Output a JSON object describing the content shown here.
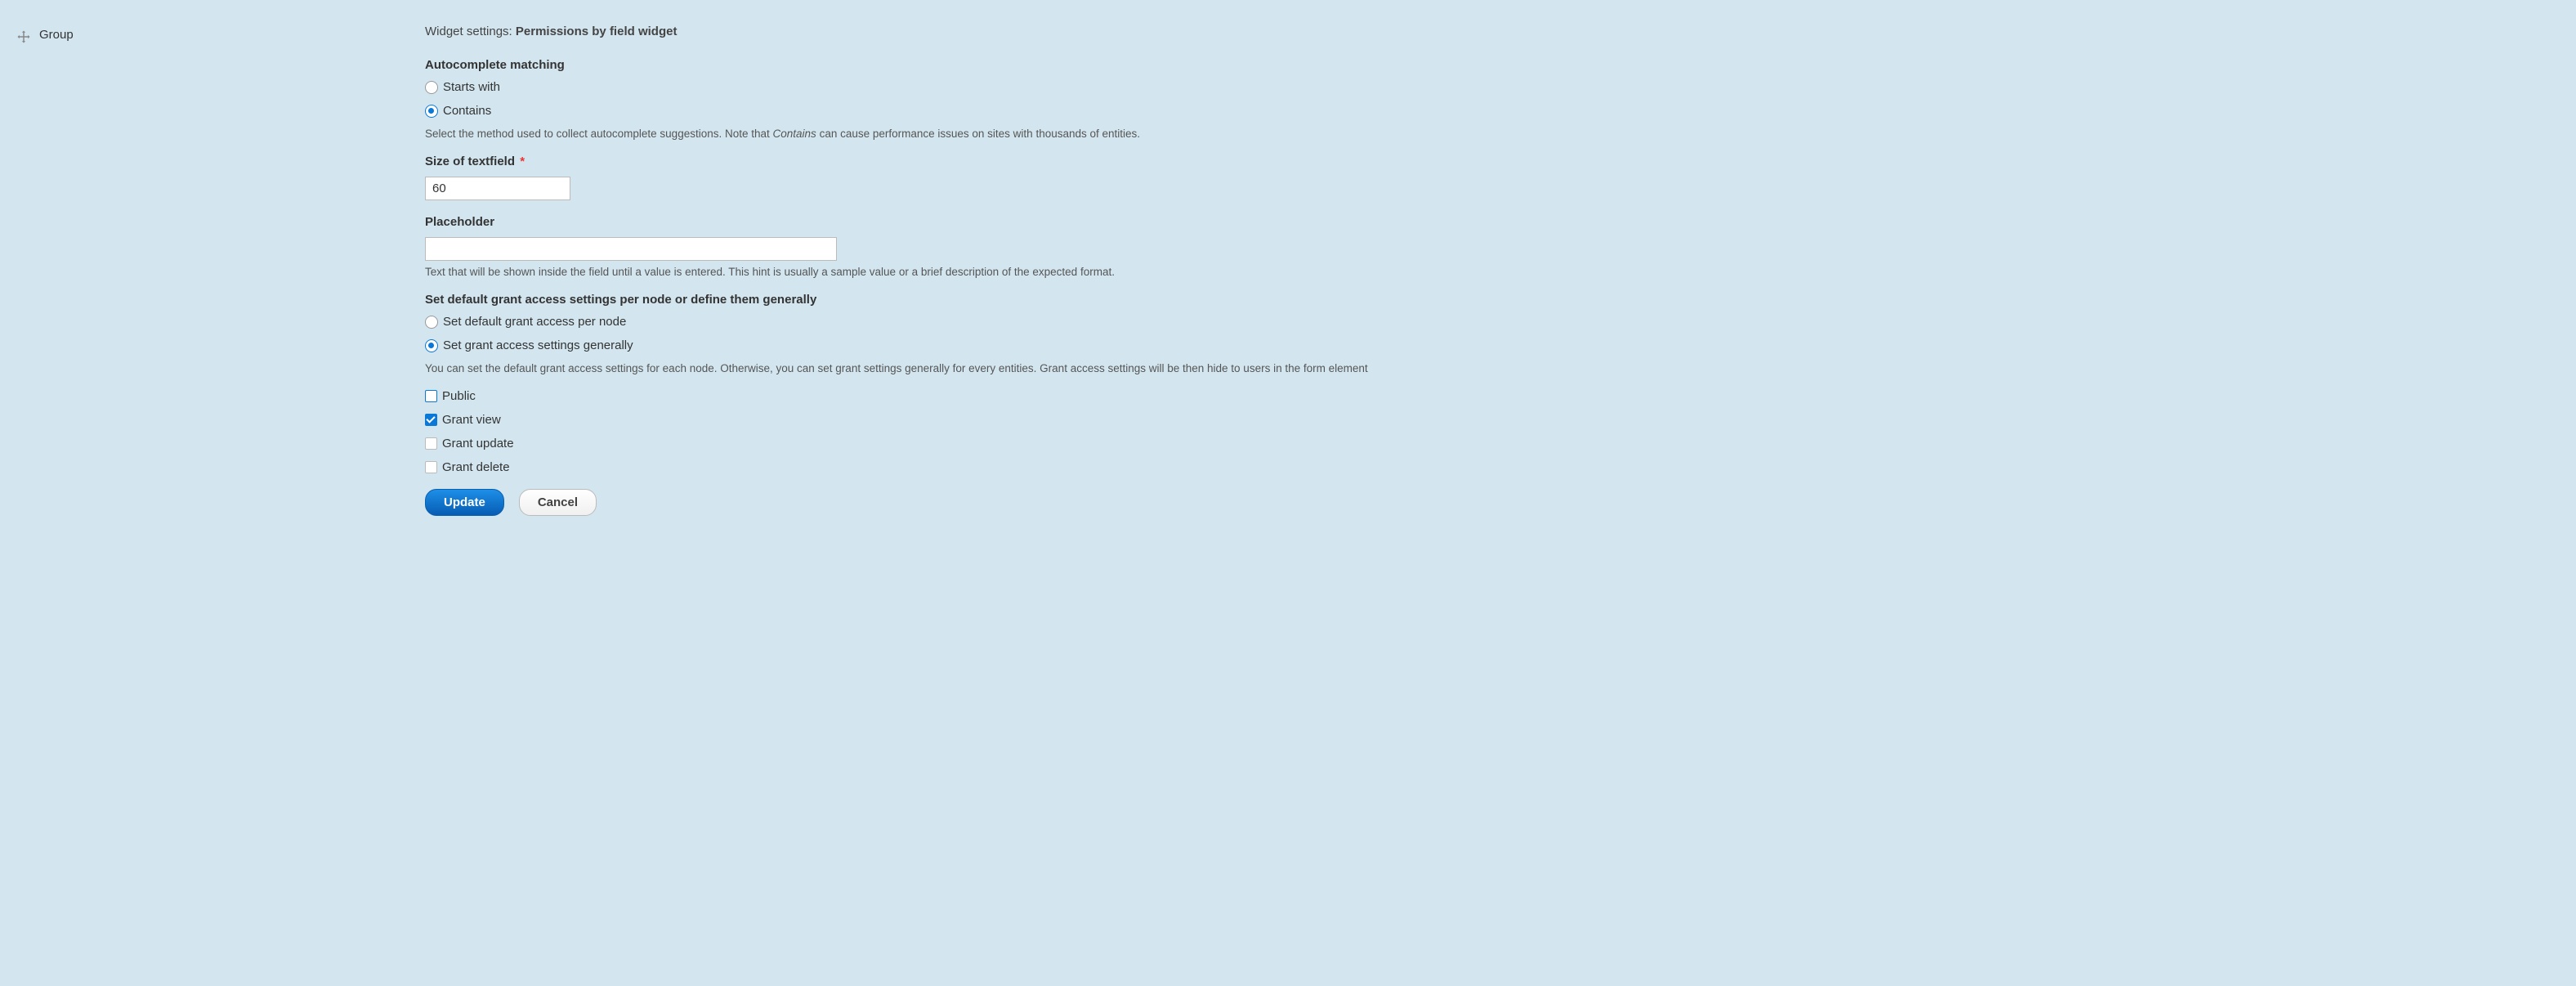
{
  "left": {
    "group_label": "Group"
  },
  "widget_settings": {
    "prefix": "Widget settings: ",
    "name": "Permissions by field widget"
  },
  "autocomplete": {
    "label": "Autocomplete matching",
    "options": {
      "starts_with": "Starts with",
      "contains": "Contains"
    },
    "help_before": "Select the method used to collect autocomplete suggestions. Note that ",
    "help_em": "Contains",
    "help_after": " can cause performance issues on sites with thousands of entities."
  },
  "size": {
    "label": "Size of textfield",
    "value": "60"
  },
  "placeholder": {
    "label": "Placeholder",
    "value": "",
    "help": "Text that will be shown inside the field until a value is entered. This hint is usually a sample value or a brief description of the expected format."
  },
  "grant_mode": {
    "label": "Set default grant access settings per node or define them generally",
    "options": {
      "per_node": "Set default grant access per node",
      "generally": "Set grant access settings generally"
    },
    "help": "You can set the default grant access settings for each node. Otherwise, you can set grant settings generally for every entities. Grant access settings will be then hide to users in the form element"
  },
  "grants": {
    "public": "Public",
    "view": "Grant view",
    "update": "Grant update",
    "delete": "Grant delete"
  },
  "actions": {
    "update": "Update",
    "cancel": "Cancel"
  }
}
